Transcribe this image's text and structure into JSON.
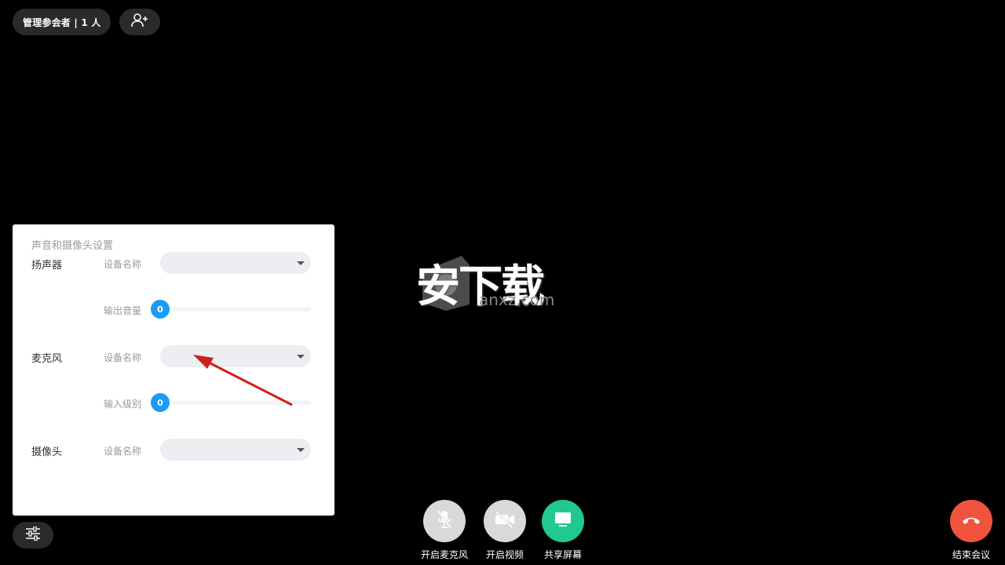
{
  "top_bar": {
    "participants_label": "管理参会者 | 1 人",
    "invite_icon": "add-user-icon"
  },
  "settings_panel": {
    "title": "声音和摄像头设置",
    "speaker": {
      "label": "扬声器",
      "device_label": "设备名称",
      "device_value": "",
      "volume_label": "输出音量",
      "volume_value": "0"
    },
    "microphone": {
      "label": "麦克风",
      "device_label": "设备名称",
      "device_value": "",
      "level_label": "输入级别",
      "level_value": "0"
    },
    "camera": {
      "label": "摄像头",
      "device_label": "设备名称",
      "device_value": ""
    }
  },
  "watermark": {
    "main": "安下载",
    "sub": "anxz.com"
  },
  "controls": {
    "mic_label": "开启麦克风",
    "video_label": "开启视频",
    "share_label": "共享屏幕",
    "end_label": "结束会议"
  },
  "colors": {
    "background": "#000000",
    "accent_blue": "#1a9cf4",
    "share_green": "#21c98f",
    "end_red": "#f2533d",
    "inactive_gray": "#d9d9d9"
  }
}
